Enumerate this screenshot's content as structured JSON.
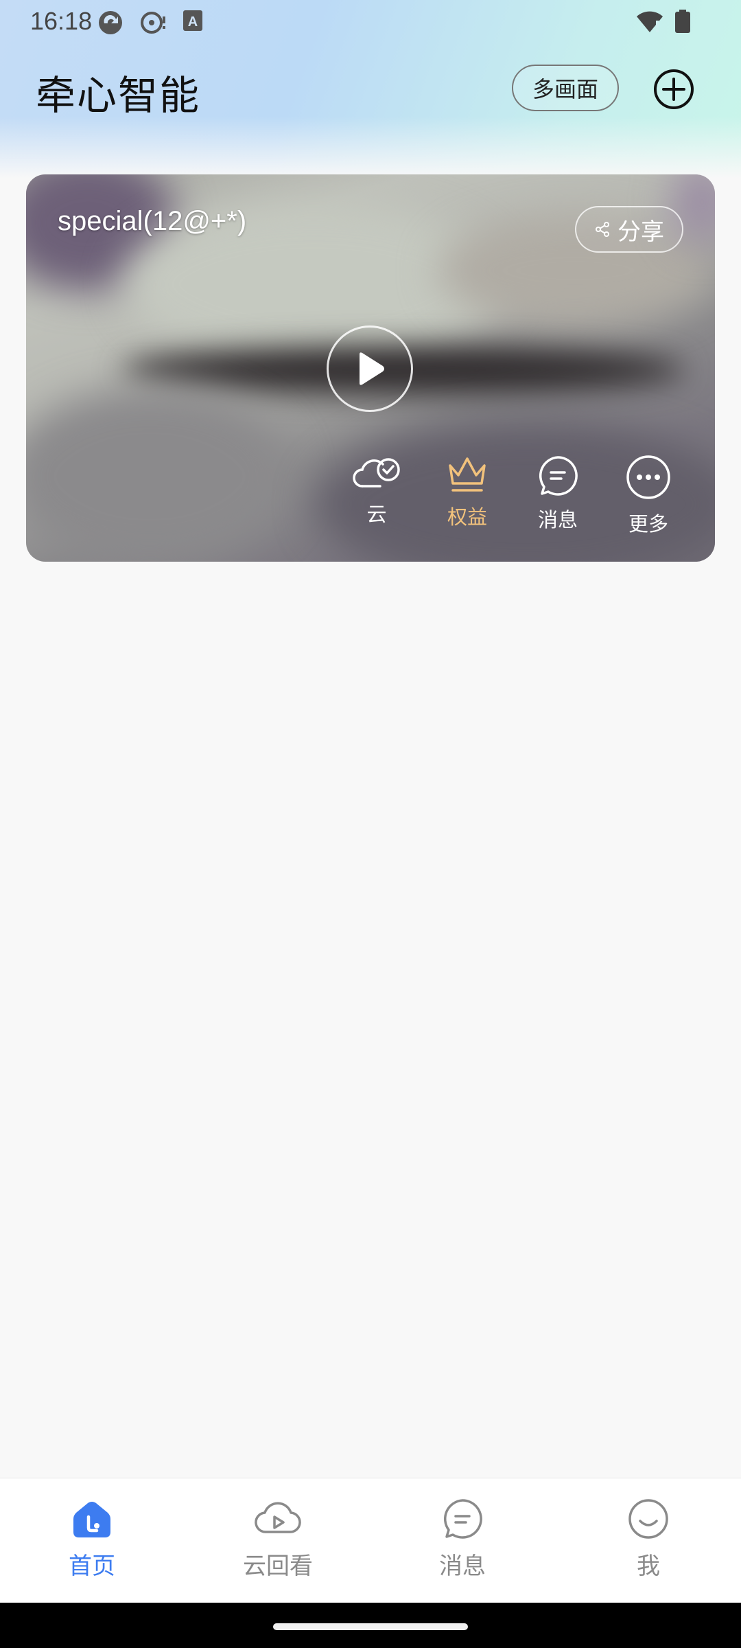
{
  "status_bar": {
    "time": "16:18"
  },
  "header": {
    "app_title": "牵心智能",
    "multi_view_label": "多画面"
  },
  "device_card": {
    "device_name": "special(12@+*)",
    "share_label": "分享",
    "actions": [
      {
        "label": "云",
        "icon": "cloud-check-icon"
      },
      {
        "label": "权益",
        "icon": "crown-icon"
      },
      {
        "label": "消息",
        "icon": "message-icon"
      },
      {
        "label": "更多",
        "icon": "more-icon"
      }
    ],
    "colors": {
      "benefits_gold": "#f2c27c"
    }
  },
  "bottom_nav": {
    "items": [
      {
        "label": "首页",
        "icon": "home-icon",
        "active": true
      },
      {
        "label": "云回看",
        "icon": "cloud-play-icon",
        "active": false
      },
      {
        "label": "消息",
        "icon": "message-icon",
        "active": false
      },
      {
        "label": "我",
        "icon": "profile-icon",
        "active": false
      }
    ],
    "colors": {
      "active": "#3d7cf0",
      "inactive": "#8a8a8a"
    }
  }
}
